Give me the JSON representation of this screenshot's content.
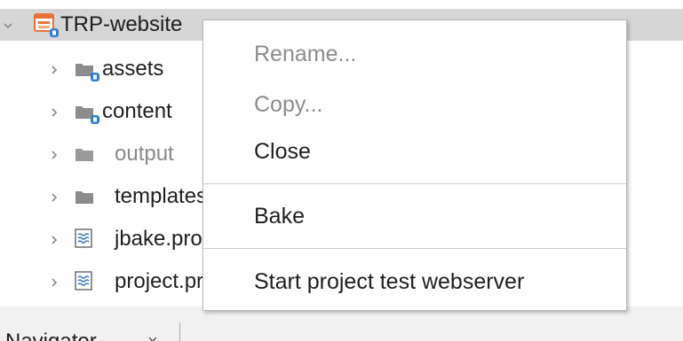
{
  "tree": {
    "root": {
      "label": "TRP-website",
      "expanded": true,
      "selected": true
    },
    "items": [
      {
        "label": "assets",
        "type": "folder",
        "shared": true
      },
      {
        "label": "content",
        "type": "folder",
        "shared": true
      },
      {
        "label": "output",
        "type": "folder",
        "derived": true
      },
      {
        "label": "templates",
        "type": "folder"
      },
      {
        "label": "jbake.properties",
        "type": "file"
      },
      {
        "label": "project.properties",
        "type": "file"
      }
    ]
  },
  "context_menu": {
    "items": [
      {
        "label": "Rename...",
        "enabled": false
      },
      {
        "label": "Copy...",
        "enabled": false
      },
      {
        "label": "Close",
        "enabled": true
      },
      {
        "label": "Bake",
        "enabled": true
      },
      {
        "label": "Start project test webserver",
        "enabled": true
      }
    ]
  },
  "bottom_panel": {
    "tab_label": "Navigator",
    "close_glyph": "×"
  },
  "colors": {
    "selection_bg": "#d6d6d6",
    "folder": "#8c8c8c",
    "project_icon": "#e8733a",
    "badge": "#2f7fd8",
    "disabled_text": "#8c8c8c"
  }
}
